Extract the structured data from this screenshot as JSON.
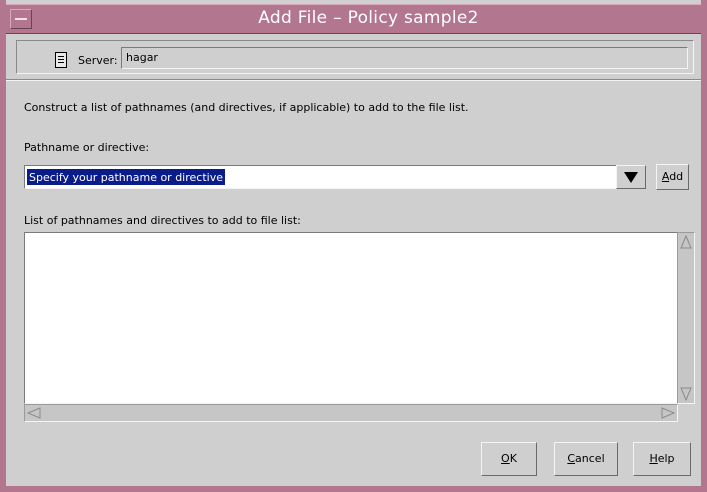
{
  "window": {
    "title": "Add File – Policy sample2"
  },
  "server": {
    "label": "Server:",
    "value": "hagar"
  },
  "instructions": "Construct a list of pathnames (and directives, if applicable) to add to the file list.",
  "pathname": {
    "label": "Pathname or directive:",
    "value": "Specify your pathname or directive",
    "add_mnemonic": "A",
    "add_rest": "dd"
  },
  "file_list": {
    "label": "List of pathnames and directives to add to file list:",
    "items": []
  },
  "footer": {
    "ok_mnemonic": "O",
    "ok_rest": "K",
    "cancel_mnemonic": "C",
    "cancel_rest": "ancel",
    "help_mnemonic": "H",
    "help_rest": "elp"
  },
  "icons": {
    "server": "server-icon",
    "window_menu": "window-menu-icon",
    "dropdown": "triangle-down-icon"
  },
  "colors": {
    "titlebar": "#b2768e",
    "selection": "#0a1c8a",
    "background": "#cfcfcf"
  }
}
